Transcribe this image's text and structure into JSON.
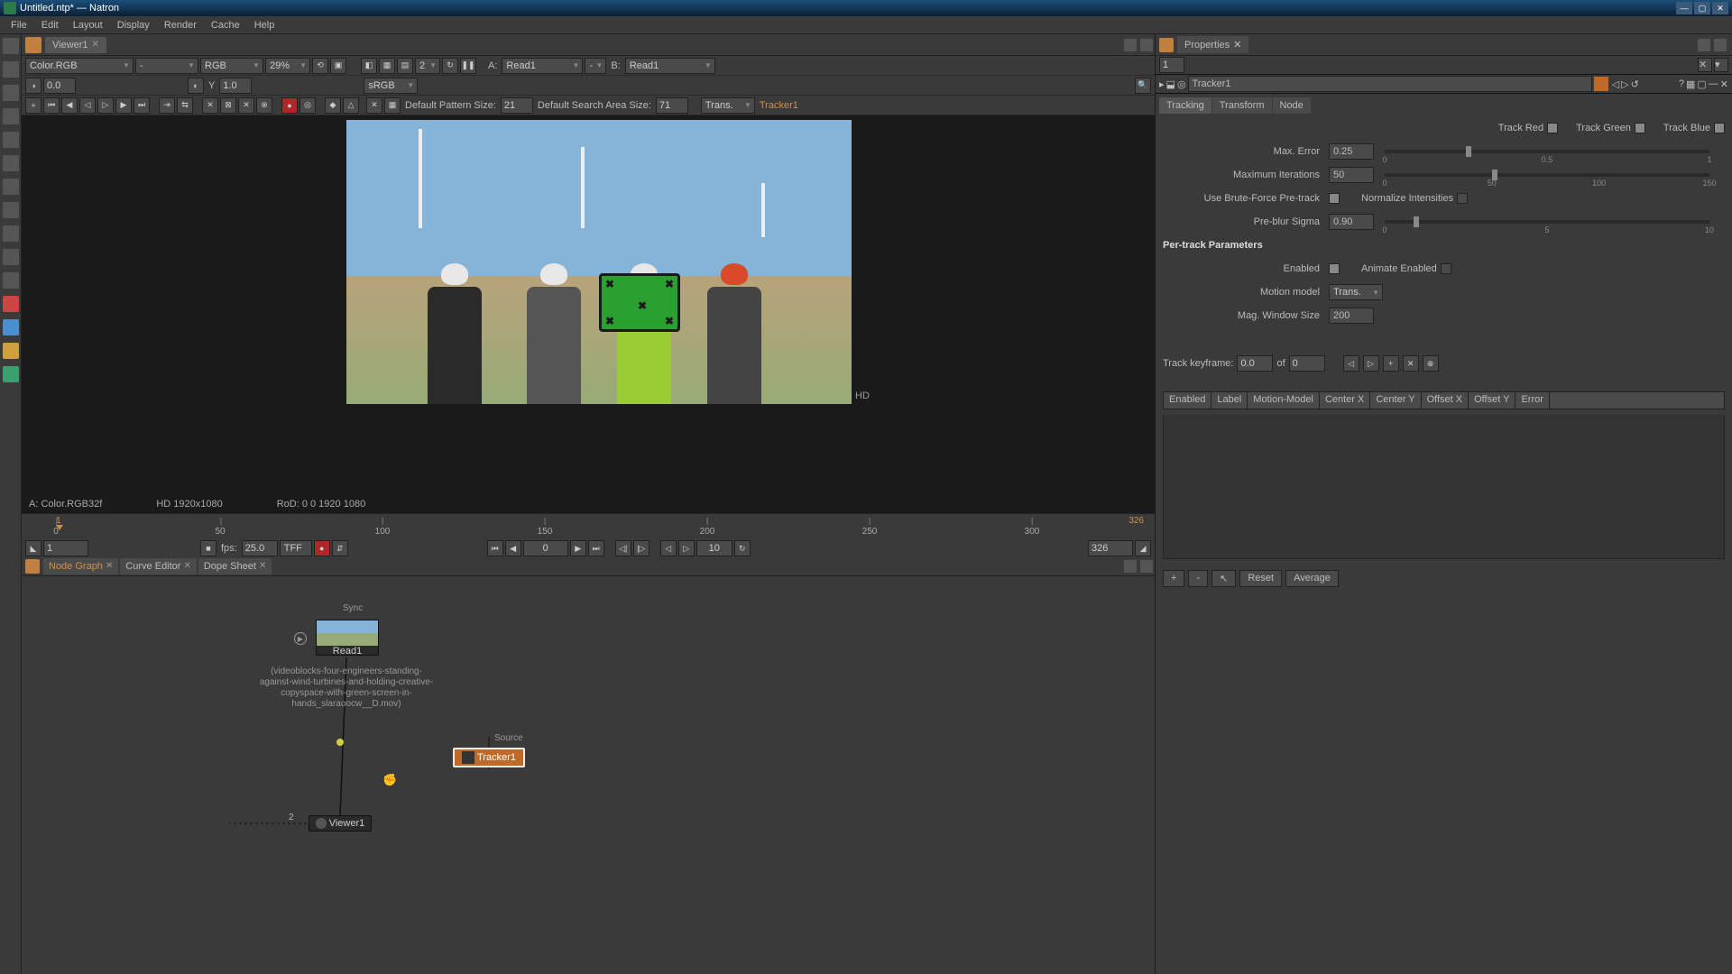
{
  "titlebar": {
    "text": "Untitled.ntp* — Natron"
  },
  "menu": {
    "file": "File",
    "edit": "Edit",
    "layout": "Layout",
    "display": "Display",
    "render": "Render",
    "cache": "Cache",
    "help": "Help"
  },
  "viewer": {
    "tab": "Viewer1",
    "layer": "Color.RGB",
    "alpha": "-",
    "channels": "RGB",
    "zoom": "29%",
    "gamma": "0.0",
    "gain": "1.0",
    "colorspace": "sRGB",
    "count2": "2",
    "A": "A:",
    "A_val": "Read1",
    "A_op": "-",
    "B": "B:",
    "B_val": "Read1",
    "pattern_lbl": "Default Pattern Size:",
    "pattern_val": "21",
    "search_lbl": "Default Search Area Size:",
    "search_val": "71",
    "motion_lbl": "Trans.",
    "tracker_name": "Tracker1",
    "meta_layer": "A: Color.RGB32f",
    "meta_fmt": "HD 1920x1080",
    "meta_rod": "RoD: 0 0 1920 1080",
    "hd": "HD"
  },
  "timeline": {
    "ticks": [
      "0",
      "50",
      "100",
      "150",
      "200",
      "250",
      "300"
    ],
    "start": "1",
    "end": "326",
    "in_frame": "1",
    "out_frame": "326",
    "cur": "0",
    "fps_lbl": "fps:",
    "fps": "25.0",
    "tff": "TFF",
    "incr": "10"
  },
  "nodegraph": {
    "tabs": {
      "ng": "Node Graph",
      "ce": "Curve Editor",
      "ds": "Dope Sheet"
    },
    "sync": "Sync",
    "read": "Read1",
    "filename": "(videoblocks-four-engineers-standing-against-wind-turbines-and-holding-creative-copyspace-with-green-screen-in-hands_slaraoocw__D.mov)",
    "tracker": "Tracker1",
    "tracker_src": "Source",
    "viewer": "Viewer1",
    "port2": "2"
  },
  "props": {
    "title": "Properties",
    "maxpanels": "1",
    "node": "Tracker1",
    "tabs": {
      "tracking": "Tracking",
      "transform": "Transform",
      "node": "Node"
    },
    "track_red": "Track Red",
    "track_green": "Track Green",
    "track_blue": "Track Blue",
    "maxerr_lbl": "Max. Error",
    "maxerr": "0.25",
    "maxit_lbl": "Maximum Iterations",
    "maxit": "50",
    "brute_lbl": "Use Brute-Force Pre-track",
    "norm_lbl": "Normalize Intensities",
    "preblur_lbl": "Pre-blur Sigma",
    "preblur": "0.90",
    "pertrack": "Per-track Parameters",
    "enabled_lbl": "Enabled",
    "anim_lbl": "Animate Enabled",
    "motion_lbl": "Motion model",
    "motion_val": "Trans.",
    "magwin_lbl": "Mag. Window Size",
    "magwin": "200",
    "kf_lbl": "Track keyframe:",
    "kf_val": "0.0",
    "kf_of": "of",
    "kf_total": "0",
    "cols": {
      "enabled": "Enabled",
      "label": "Label",
      "mm": "Motion-Model",
      "cx": "Center X",
      "cy": "Center Y",
      "ox": "Offset X",
      "oy": "Offset Y",
      "err": "Error"
    },
    "btn_plus": "+",
    "btn_minus": "-",
    "btn_reset": "Reset",
    "btn_avg": "Average",
    "slider_err": {
      "t0": "0",
      "t1": "0.5",
      "t2": "1"
    },
    "slider_it": {
      "t0": "0",
      "t1": "50",
      "t2": "100",
      "t3": "150"
    },
    "slider_pb": {
      "t0": "0",
      "t1": "5",
      "t2": "10"
    }
  }
}
